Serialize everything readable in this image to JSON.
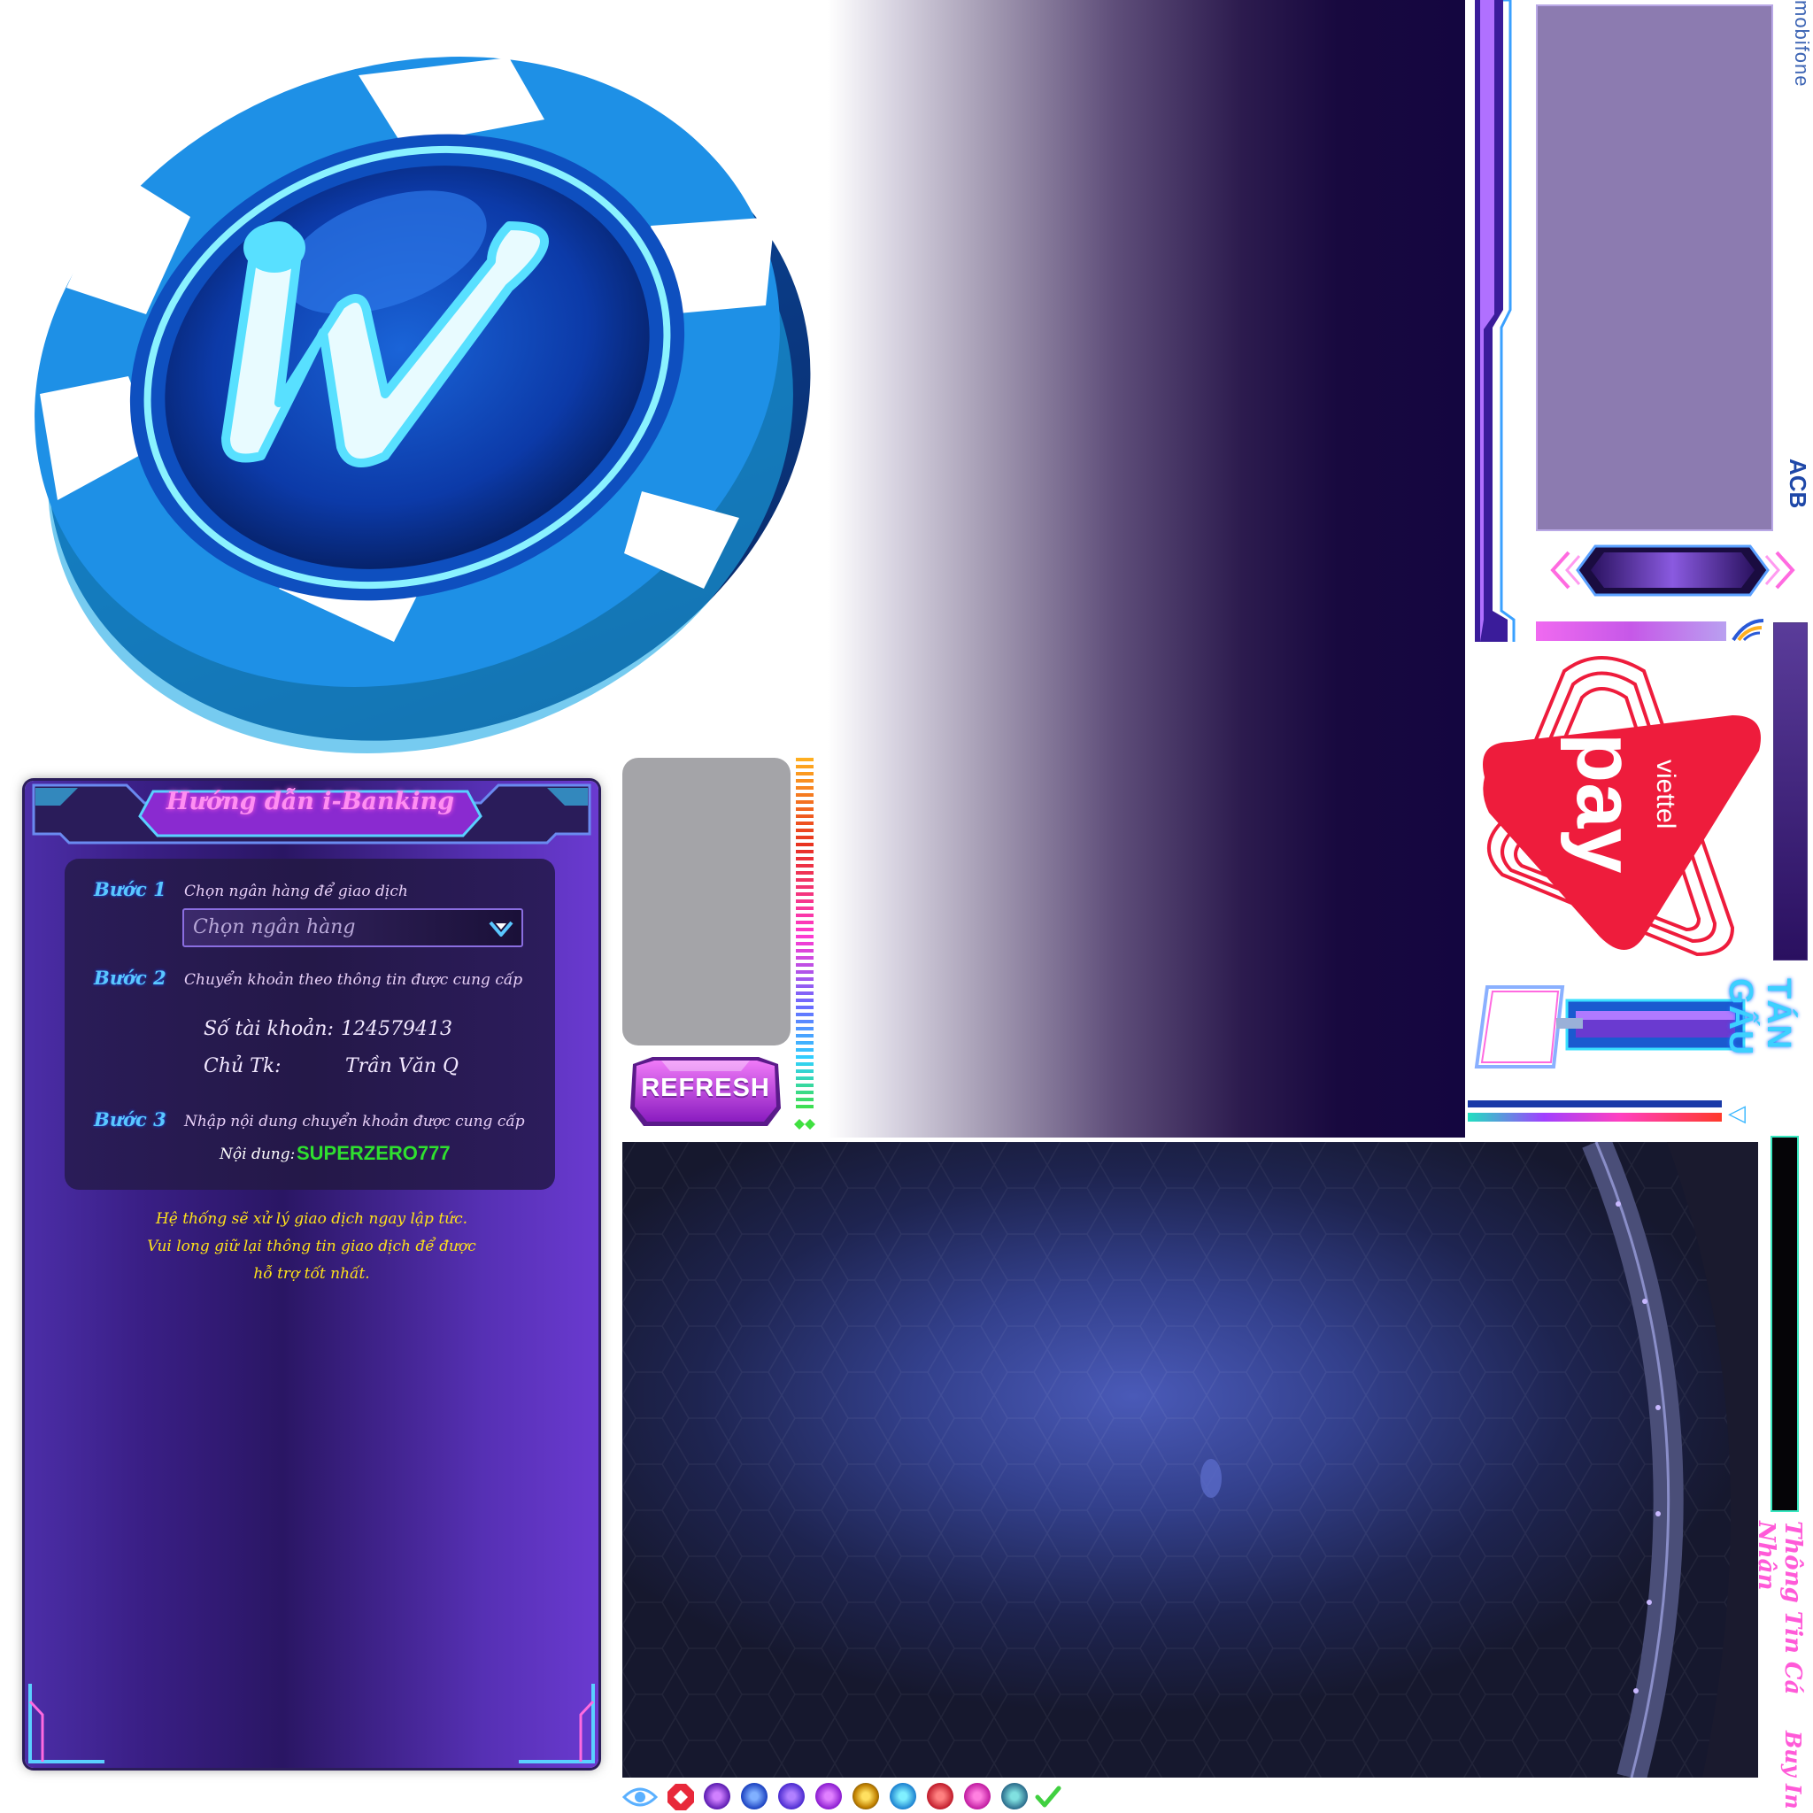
{
  "logo": {
    "letter": "w"
  },
  "brands": {
    "mobifone": "mobifone",
    "acb": "ACB",
    "viettel_small": "viettel",
    "viettel_big": "pay"
  },
  "labels": {
    "tan_gau": "TÁN GẤU",
    "thong_tin": "Thông Tin Cá Nhân",
    "buy_in": "Buy In",
    "refresh": "REFRESH"
  },
  "bank_guide": {
    "title": "Hướng dẫn i-Banking",
    "step1_label": "Bước 1",
    "step1_desc": "Chọn ngân hàng để giao dịch",
    "select_placeholder": "Chọn ngân hàng",
    "step2_label": "Bước 2",
    "step2_desc": "Chuyển khoản theo thông tin được cung cấp",
    "account_label": "Số tài khoản:",
    "account_value": "124579413",
    "owner_label": "Chủ Tk:",
    "owner_value": "Trần Văn Q",
    "step3_label": "Bước 3",
    "step3_desc": "Nhập nội dung chuyển khoản được cung cấp",
    "content_label": "Nội dung:",
    "content_value": "SUPERZERO777",
    "note_line1": "Hệ thống sẽ xử lý giao dịch ngay lập tức.",
    "note_line2": "Vui long giữ lại thông tin giao dịch để được",
    "note_line3": "hỗ trợ tốt nhất."
  },
  "colors": {
    "accent_blue": "#1e90e6",
    "neon_pink": "#ff5ad8",
    "content_green": "#2fe02f",
    "note_yellow": "#ffe21a",
    "viettel_red": "#ee1c3c"
  },
  "icons": [
    "eye-icon",
    "octagon-red-icon",
    "orb-purple-icon",
    "orb-blue-icon",
    "orb-violet-icon",
    "orb-purple-icon",
    "orb-yellow-icon",
    "orb-cyan-icon",
    "orb-red-icon",
    "orb-magenta-icon",
    "orb-teal-icon",
    "check-icon"
  ]
}
